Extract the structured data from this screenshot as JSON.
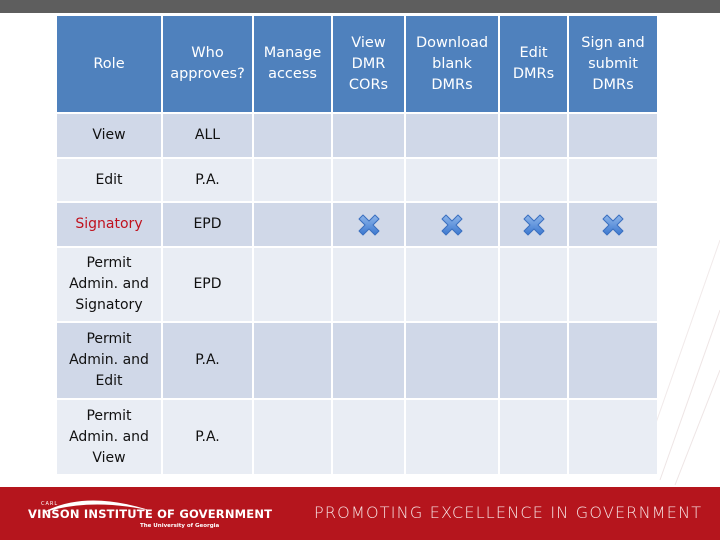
{
  "table": {
    "headers": [
      [
        "Role"
      ],
      [
        "Who",
        "approves?"
      ],
      [
        "Manage",
        "access"
      ],
      [
        "View",
        "DMR",
        "CORs"
      ],
      [
        "Download",
        "blank",
        "DMRs"
      ],
      [
        "Edit",
        "DMRs"
      ],
      [
        "Sign and",
        "submit",
        "DMRs"
      ]
    ],
    "rows": [
      {
        "role": [
          "View"
        ],
        "approver": "ALL",
        "highlight": false,
        "permissions": [
          false,
          false,
          false,
          false,
          false
        ]
      },
      {
        "role": [
          "Edit"
        ],
        "approver": "P.A.",
        "highlight": false,
        "permissions": [
          false,
          false,
          false,
          false,
          false
        ]
      },
      {
        "role": [
          "Signatory"
        ],
        "approver": "EPD",
        "highlight": true,
        "permissions": [
          false,
          true,
          true,
          true,
          true
        ]
      },
      {
        "role": [
          "Permit",
          "Admin. and",
          "Signatory"
        ],
        "approver": "EPD",
        "highlight": false,
        "permissions": [
          false,
          false,
          false,
          false,
          false
        ]
      },
      {
        "role": [
          "Permit",
          "Admin. and",
          "Edit"
        ],
        "approver": "P.A.",
        "highlight": false,
        "permissions": [
          false,
          false,
          false,
          false,
          false
        ]
      },
      {
        "role": [
          "Permit",
          "Admin. and",
          "View"
        ],
        "approver": "P.A.",
        "highlight": false,
        "permissions": [
          false,
          false,
          false,
          false,
          false
        ]
      }
    ],
    "mark_icon": "x-mark-icon",
    "colors": {
      "header": "#4f81bd",
      "row_dark": "#d0d8e8",
      "row_light": "#e9edf4",
      "highlight_text": "#c0121e",
      "mark": "#4a86d8"
    }
  },
  "footer": {
    "logo_small": "CARL",
    "logo_name": "VINSON INSTITUTE OF GOVERNMENT",
    "logo_sub": "The University of Georgia",
    "tagline": "PROMOTING EXCELLENCE IN GOVERNMENT",
    "color": "#b5151d"
  }
}
